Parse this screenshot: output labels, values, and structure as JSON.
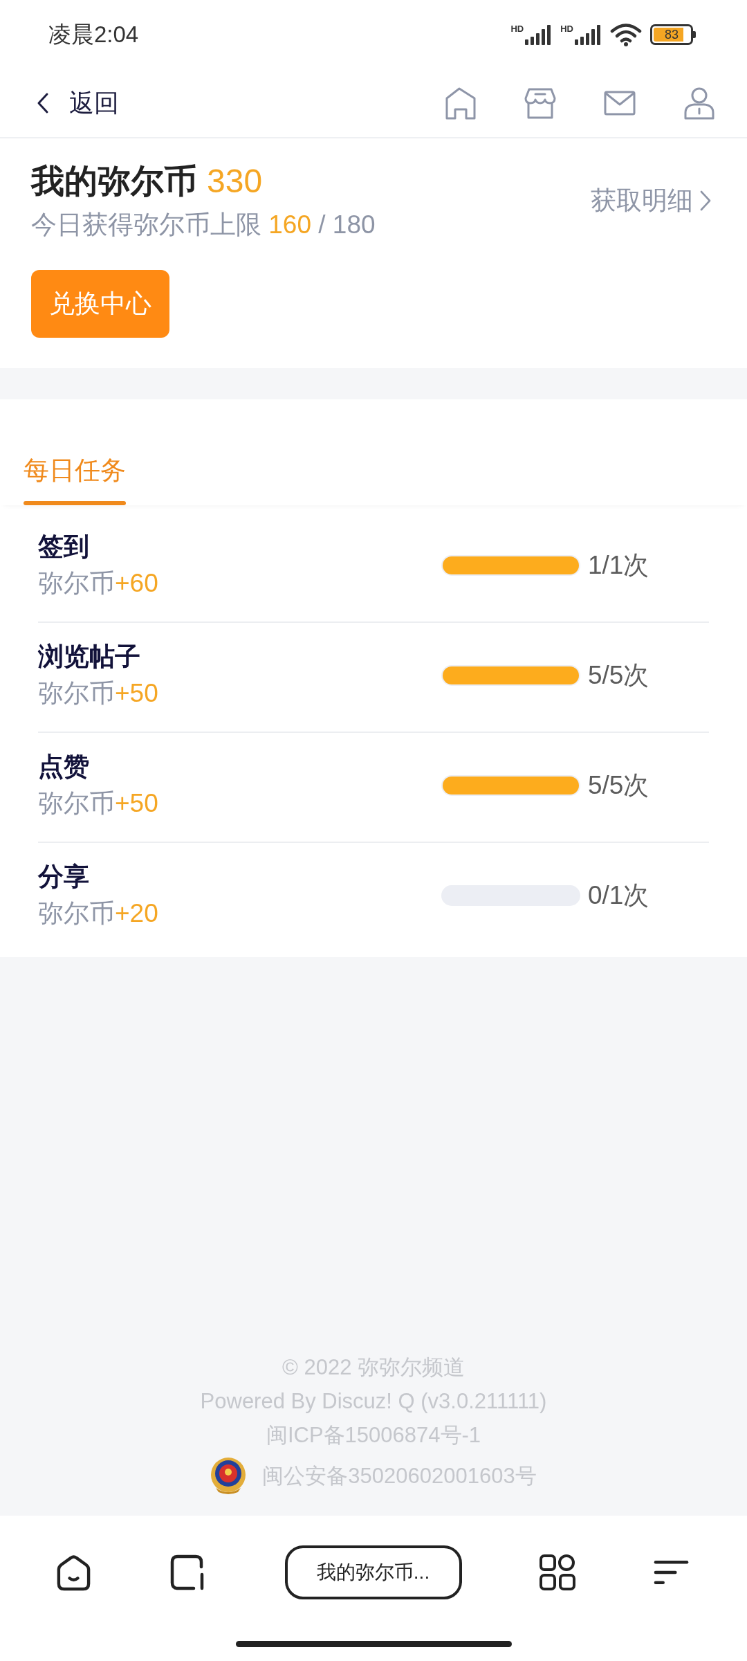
{
  "status_bar": {
    "time": "凌晨2:04",
    "signals": [
      {
        "label": "HD"
      },
      {
        "label": "HD"
      }
    ],
    "battery": "83"
  },
  "header": {
    "back_label": "返回"
  },
  "summary": {
    "title": "我的弥尔币",
    "balance": "330",
    "limit": {
      "label": "今日获得弥尔币上限",
      "earned": "160",
      "max": "/ 180"
    },
    "details_link": "获取明细",
    "exchange_button": "兑换中心"
  },
  "tabs": [
    {
      "label": "每日任务",
      "selected": true
    }
  ],
  "tasks": [
    {
      "name": "签到",
      "reward_label": "弥尔币",
      "reward": "+60",
      "level": 1,
      "reading": "1/1次"
    },
    {
      "name": "浏览帖子",
      "reward_label": "弥尔币",
      "reward": "+50",
      "level": 1,
      "reading": "5/5次"
    },
    {
      "name": "点赞",
      "reward_label": "弥尔币",
      "reward": "+50",
      "level": 1,
      "reading": "5/5次"
    },
    {
      "name": "分享",
      "reward_label": "弥尔币",
      "reward": "+20",
      "level": 0,
      "reading": "0/1次"
    }
  ],
  "footer": {
    "copyright": "© 2022 弥弥尔频道",
    "powered_by": "Powered By Discuz! Q (v3.0.211111)",
    "icp": "闽ICP备15006874号-1",
    "police_record": "闽公安备35020602001603号"
  },
  "browser_bar": {
    "page_title": "我的弥尔币..."
  }
}
